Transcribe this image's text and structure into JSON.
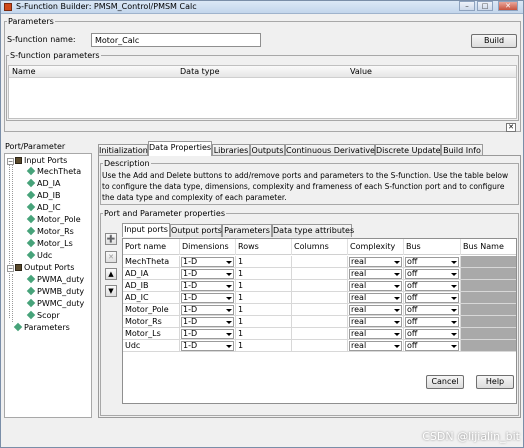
{
  "window": {
    "title": "S-Function Builder: PMSM_Control/PMSM Calc"
  },
  "parameters": {
    "group_label": "Parameters",
    "sfunction_name_label": "S-function name:",
    "sfunction_name_value": "Motor_Calc",
    "build_label": "Build",
    "sfunction_parameters_label": "S-function parameters",
    "columns": [
      "Name",
      "Data type",
      "Value"
    ]
  },
  "port_parameter": {
    "group_label": "Port/Parameter",
    "tree": {
      "input_ports": "Input Ports",
      "inputs": [
        "MechTheta",
        "AD_IA",
        "AD_IB",
        "AD_IC",
        "Motor_Pole",
        "Motor_Rs",
        "Motor_Ls",
        "Udc"
      ],
      "output_ports": "Output Ports",
      "outputs": [
        "PWMA_duty",
        "PWMB_duty",
        "PWMC_duty",
        "Scopr"
      ],
      "parameters": "Parameters"
    }
  },
  "tabs": [
    "Initialization",
    "Data Properties",
    "Libraries",
    "Outputs",
    "Continuous Derivatives",
    "Discrete Update",
    "Build Info"
  ],
  "description": {
    "label": "Description",
    "text": "Use the Add and Delete buttons to add/remove ports and parameters to the S-function. Use the table below to configure the data type, dimensions, complexity and frameness of each S-function port and to configure the data type and complexity of each parameter."
  },
  "port_props": {
    "label": "Port and Parameter properties",
    "tabs": [
      "Input ports",
      "Output ports",
      "Parameters",
      "Data type attributes"
    ],
    "columns": [
      "Port name",
      "Dimensions",
      "Rows",
      "Columns",
      "Complexity",
      "Bus",
      "Bus Name"
    ],
    "rows": [
      {
        "name": "MechTheta",
        "dim": "1-D",
        "rows": "1",
        "complexity": "real",
        "bus": "off"
      },
      {
        "name": "AD_IA",
        "dim": "1-D",
        "rows": "1",
        "complexity": "real",
        "bus": "off"
      },
      {
        "name": "AD_IB",
        "dim": "1-D",
        "rows": "1",
        "complexity": "real",
        "bus": "off"
      },
      {
        "name": "AD_IC",
        "dim": "1-D",
        "rows": "1",
        "complexity": "real",
        "bus": "off"
      },
      {
        "name": "Motor_Pole",
        "dim": "1-D",
        "rows": "1",
        "complexity": "real",
        "bus": "off"
      },
      {
        "name": "Motor_Rs",
        "dim": "1-D",
        "rows": "1",
        "complexity": "real",
        "bus": "off"
      },
      {
        "name": "Motor_Ls",
        "dim": "1-D",
        "rows": "1",
        "complexity": "real",
        "bus": "off"
      },
      {
        "name": "Udc",
        "dim": "1-D",
        "rows": "1",
        "complexity": "real",
        "bus": "off"
      }
    ]
  },
  "buttons": {
    "cancel": "Cancel",
    "help": "Help"
  },
  "watermark": "CSDN @lijialin_bit",
  "colors": {
    "tree_icon": "#47a37a",
    "folder": "#5a4a2c",
    "readonly_cell": "#a9a9a9"
  },
  "icons": [
    "add-icon",
    "delete-icon",
    "move-up-icon",
    "move-down-icon",
    "close-icon"
  ]
}
